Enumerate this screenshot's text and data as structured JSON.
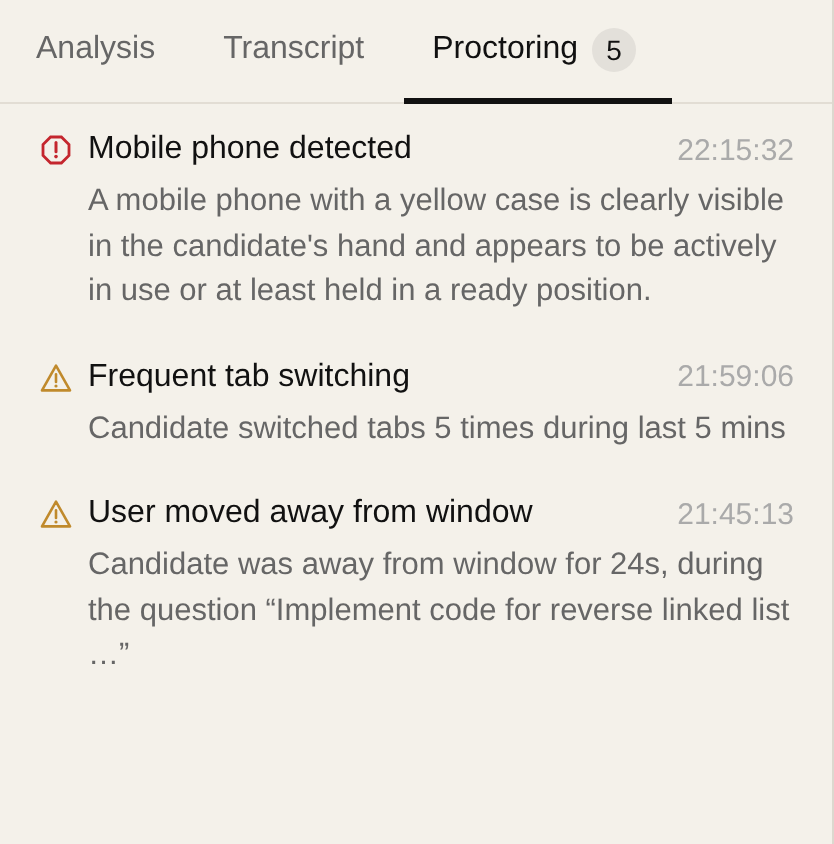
{
  "tabs": [
    {
      "label": "Analysis",
      "selected": false
    },
    {
      "label": "Transcript",
      "selected": false
    },
    {
      "label": "Proctoring",
      "selected": true,
      "count": "5"
    }
  ],
  "alerts": [
    {
      "kind": "critical",
      "title": "Mobile phone detected",
      "time": "22:15:32",
      "description": "A mobile phone with a yellow case is clearly visible in the candidate's hand and appears to be actively in use or at least held in a ready position."
    },
    {
      "kind": "warning",
      "title": "Frequent tab switching",
      "time": "21:59:06",
      "description": "Candidate switched tabs 5 times during last 5 mins"
    },
    {
      "kind": "warning",
      "title": "User moved away from window",
      "time": "21:45:13",
      "description": "Candidate was away from window for 24s, during the question “Implement code for reverse linked list …”"
    }
  ]
}
